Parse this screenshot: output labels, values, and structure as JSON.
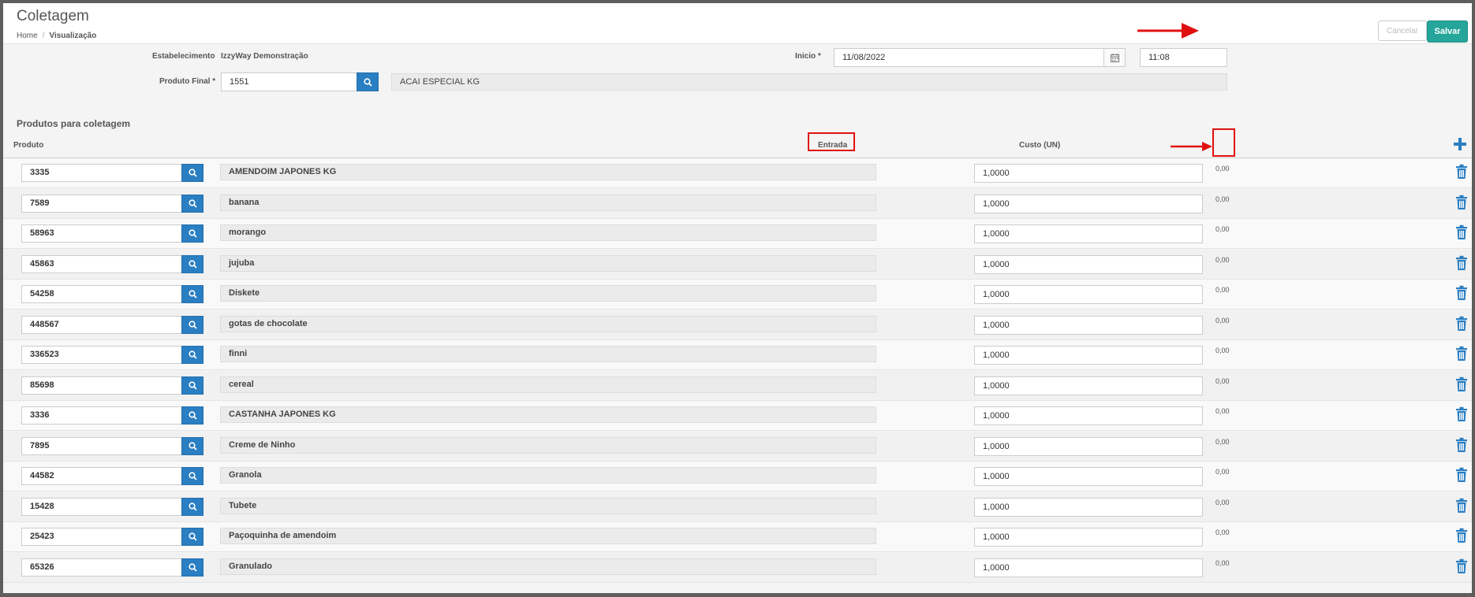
{
  "header": {
    "title": "Coletagem",
    "breadcrumb": [
      "Home",
      "Visualização"
    ],
    "cancel_label": "Cancelar",
    "save_label": "Salvar"
  },
  "form": {
    "estabelecimento_label": "Estabelecimento",
    "estabelecimento_value": "IzzyWay Demonstração",
    "produto_final_label": "Produto Final *",
    "produto_final_code": "1551",
    "produto_final_name": "ACAI ESPECIAL KG",
    "inicio_label": "Inicio *",
    "inicio_date": "11/08/2022",
    "inicio_time": "11:08"
  },
  "table": {
    "section_title": "Produtos para coletagem",
    "headers": {
      "produto": "Produto",
      "entrada": "Entrada",
      "custo": "Custo (UN)"
    },
    "rows": [
      {
        "code": "3335",
        "name": "AMENDOIM JAPONES KG",
        "entrada": "1,0000",
        "custo": "0,00"
      },
      {
        "code": "7589",
        "name": "banana",
        "entrada": "1,0000",
        "custo": "0,00"
      },
      {
        "code": "58963",
        "name": "morango",
        "entrada": "1,0000",
        "custo": "0,00"
      },
      {
        "code": "45863",
        "name": "jujuba",
        "entrada": "1,0000",
        "custo": "0,00"
      },
      {
        "code": "54258",
        "name": "Diskete",
        "entrada": "1,0000",
        "custo": "0,00"
      },
      {
        "code": "448567",
        "name": "gotas de chocolate",
        "entrada": "1,0000",
        "custo": "0,00"
      },
      {
        "code": "336523",
        "name": "finni",
        "entrada": "1,0000",
        "custo": "0,00"
      },
      {
        "code": "85698",
        "name": "cereal",
        "entrada": "1,0000",
        "custo": "0,00"
      },
      {
        "code": "3336",
        "name": "CASTANHA JAPONES KG",
        "entrada": "1,0000",
        "custo": "0,00"
      },
      {
        "code": "7895",
        "name": "Creme de Ninho",
        "entrada": "1,0000",
        "custo": "0,00"
      },
      {
        "code": "44582",
        "name": "Granola",
        "entrada": "1,0000",
        "custo": "0,00"
      },
      {
        "code": "15428",
        "name": "Tubete",
        "entrada": "1,0000",
        "custo": "0,00"
      },
      {
        "code": "25423",
        "name": "Paçoquinha de amendoim",
        "entrada": "1,0000",
        "custo": "0,00"
      },
      {
        "code": "65326",
        "name": "Granulado",
        "entrada": "1,0000",
        "custo": "0,00"
      }
    ]
  },
  "colors": {
    "primary": "#2a7ec2",
    "save": "#26a69a",
    "highlight": "#e01010"
  },
  "icons": [
    "search-icon",
    "calendar-icon",
    "plus-icon",
    "trash-icon",
    "arrow-annotation"
  ]
}
